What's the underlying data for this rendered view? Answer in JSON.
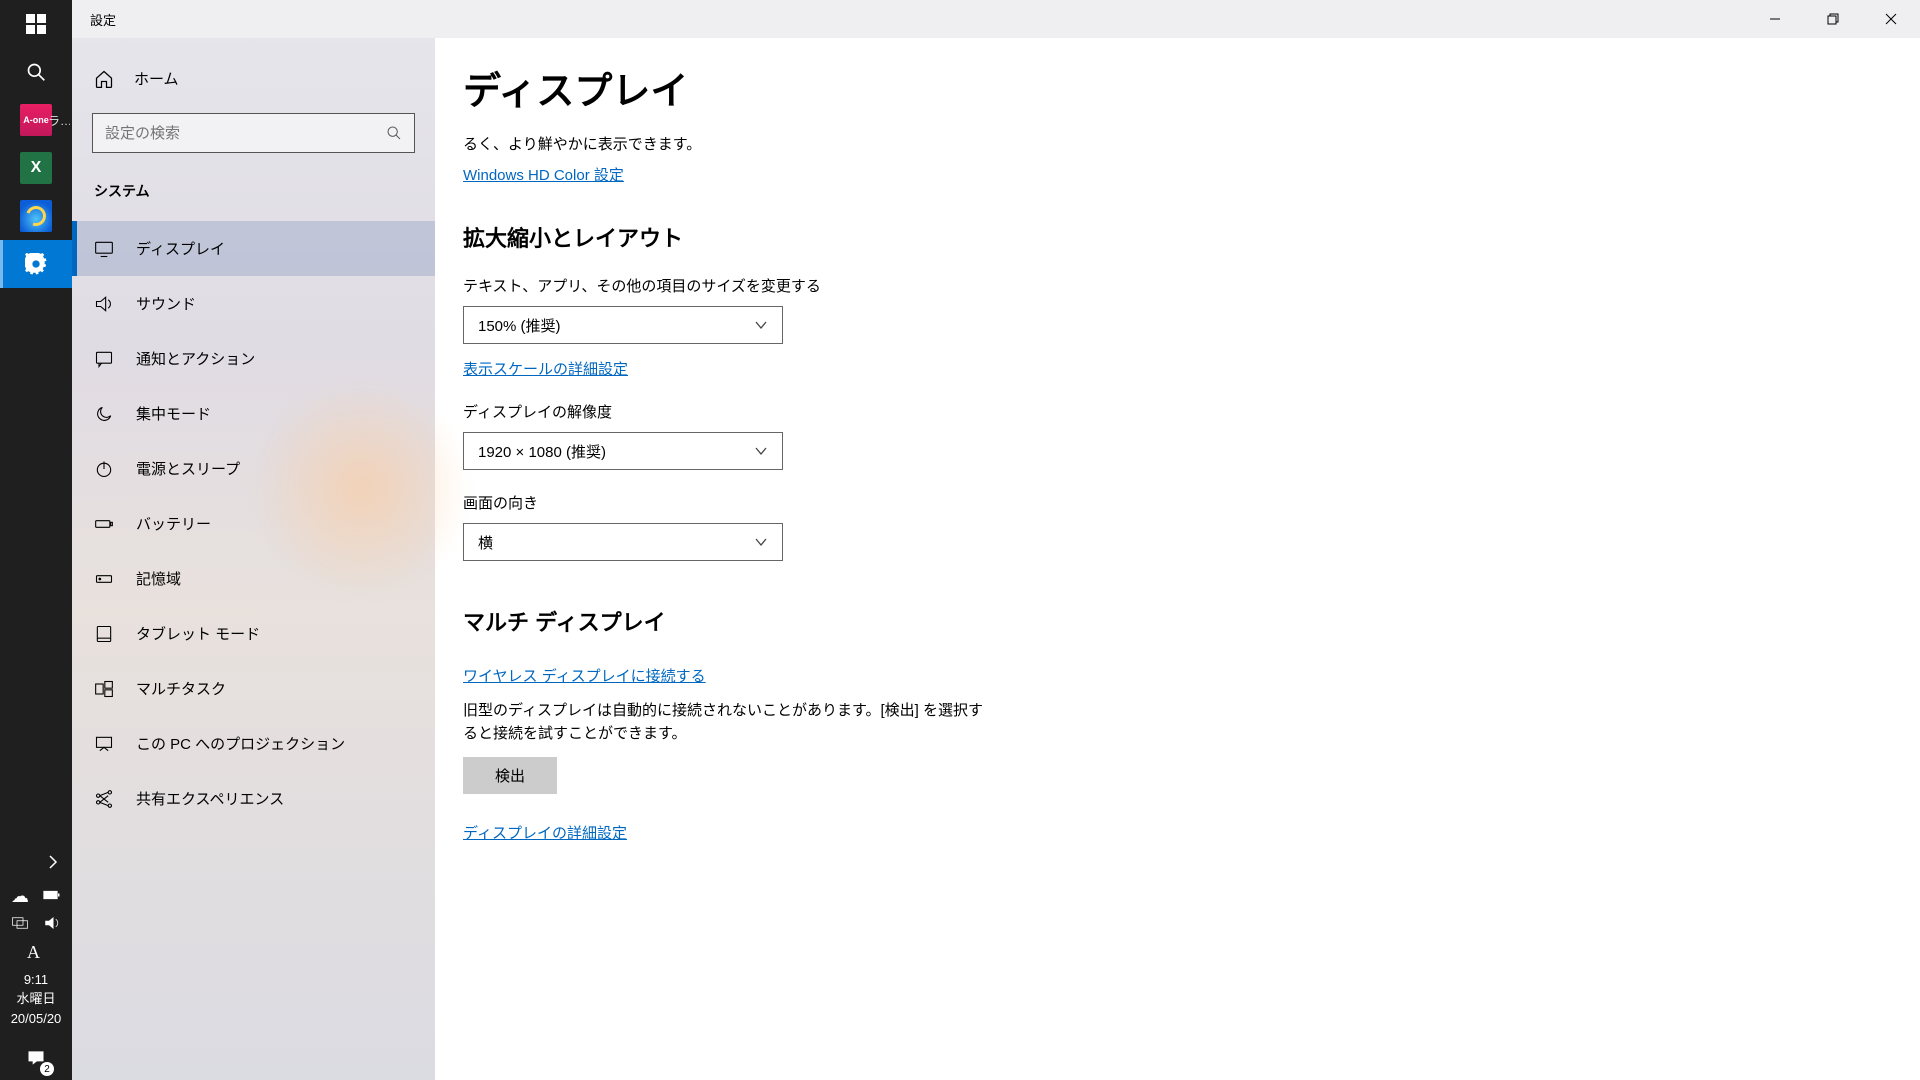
{
  "taskbar": {
    "aone_label": "ラ…",
    "clock": {
      "time": "9:11",
      "day": "水曜日",
      "date": "20/05/20"
    },
    "action_center_count": "2"
  },
  "window": {
    "title": "設定"
  },
  "sidebar": {
    "home": "ホーム",
    "search_placeholder": "設定の検索",
    "section": "システム",
    "items": [
      {
        "label": "ディスプレイ"
      },
      {
        "label": "サウンド"
      },
      {
        "label": "通知とアクション"
      },
      {
        "label": "集中モード"
      },
      {
        "label": "電源とスリープ"
      },
      {
        "label": "バッテリー"
      },
      {
        "label": "記憶域"
      },
      {
        "label": "タブレット モード"
      },
      {
        "label": "マルチタスク"
      },
      {
        "label": "この PC へのプロジェクション"
      },
      {
        "label": "共有エクスペリエンス"
      }
    ]
  },
  "main": {
    "heading": "ディスプレイ",
    "hdr_tail": "るく、より鮮やかに表示できます。",
    "hdr_link": "Windows HD Color 設定",
    "section_scale": "拡大縮小とレイアウト",
    "label_textsize": "テキスト、アプリ、その他の項目のサイズを変更する",
    "value_textsize": "150% (推奨)",
    "link_scale": "表示スケールの詳細設定",
    "label_resolution": "ディスプレイの解像度",
    "value_resolution": "1920 × 1080 (推奨)",
    "label_orientation": "画面の向き",
    "value_orientation": "横",
    "section_multi": "マルチ ディスプレイ",
    "link_wireless": "ワイヤレス ディスプレイに接続する",
    "desc_detect": "旧型のディスプレイは自動的に接続されないことがあります。[検出] を選択すると接続を試すことができます。",
    "btn_detect": "検出",
    "link_adv_display": "ディスプレイの詳細設定"
  }
}
